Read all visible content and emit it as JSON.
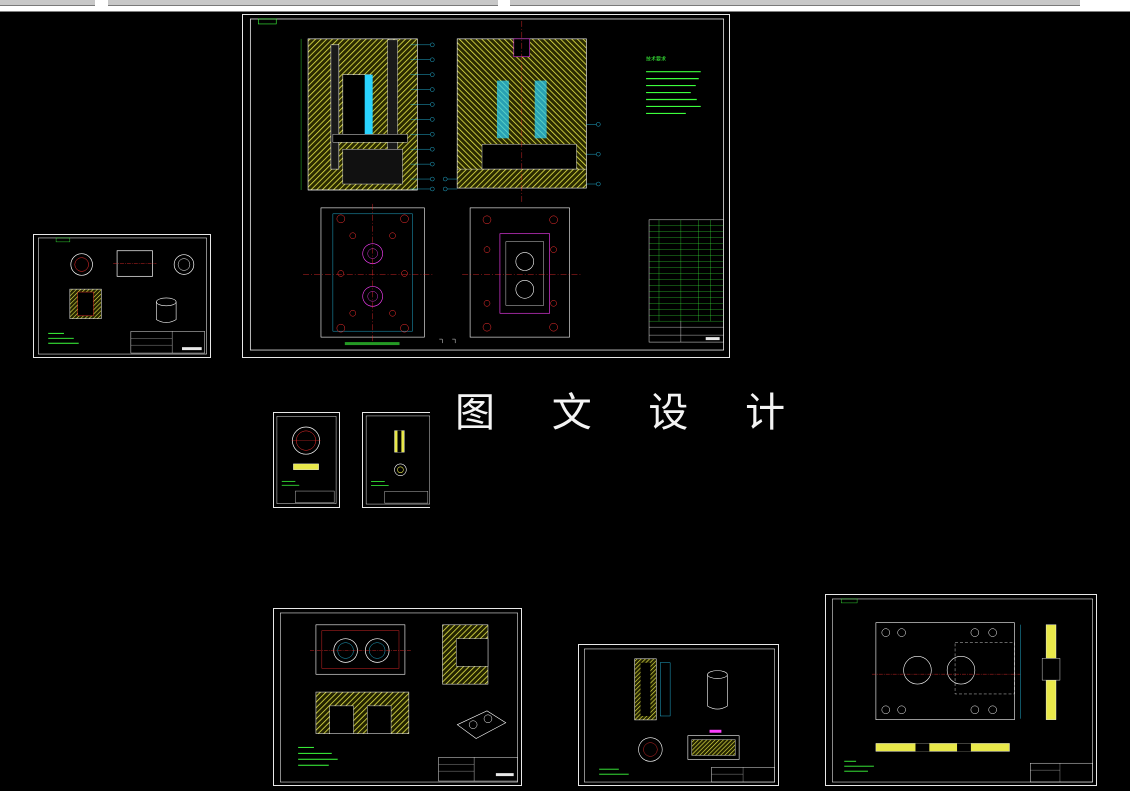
{
  "viewer": {
    "tabs": [
      {
        "label": ""
      },
      {
        "label": ""
      },
      {
        "label": ""
      }
    ]
  },
  "watermark": "图 文 设 计",
  "sheets": [
    {
      "name": "assembly-drawing",
      "tech_notes_title": "技术要求"
    },
    {
      "name": "part-sleeve"
    },
    {
      "name": "part-ring"
    },
    {
      "name": "part-pin"
    },
    {
      "name": "part-cavity-plate"
    },
    {
      "name": "part-core-insert"
    },
    {
      "name": "part-template-plate"
    }
  ],
  "colors": {
    "background": "#000000",
    "frame": "#e8e8e8",
    "hatch": "#e8e84a",
    "outline": "#ffffff",
    "dim": "#2ad4ff",
    "text": "#3cff3c",
    "center": "#ff3030",
    "bolt": "#ff40ff"
  }
}
